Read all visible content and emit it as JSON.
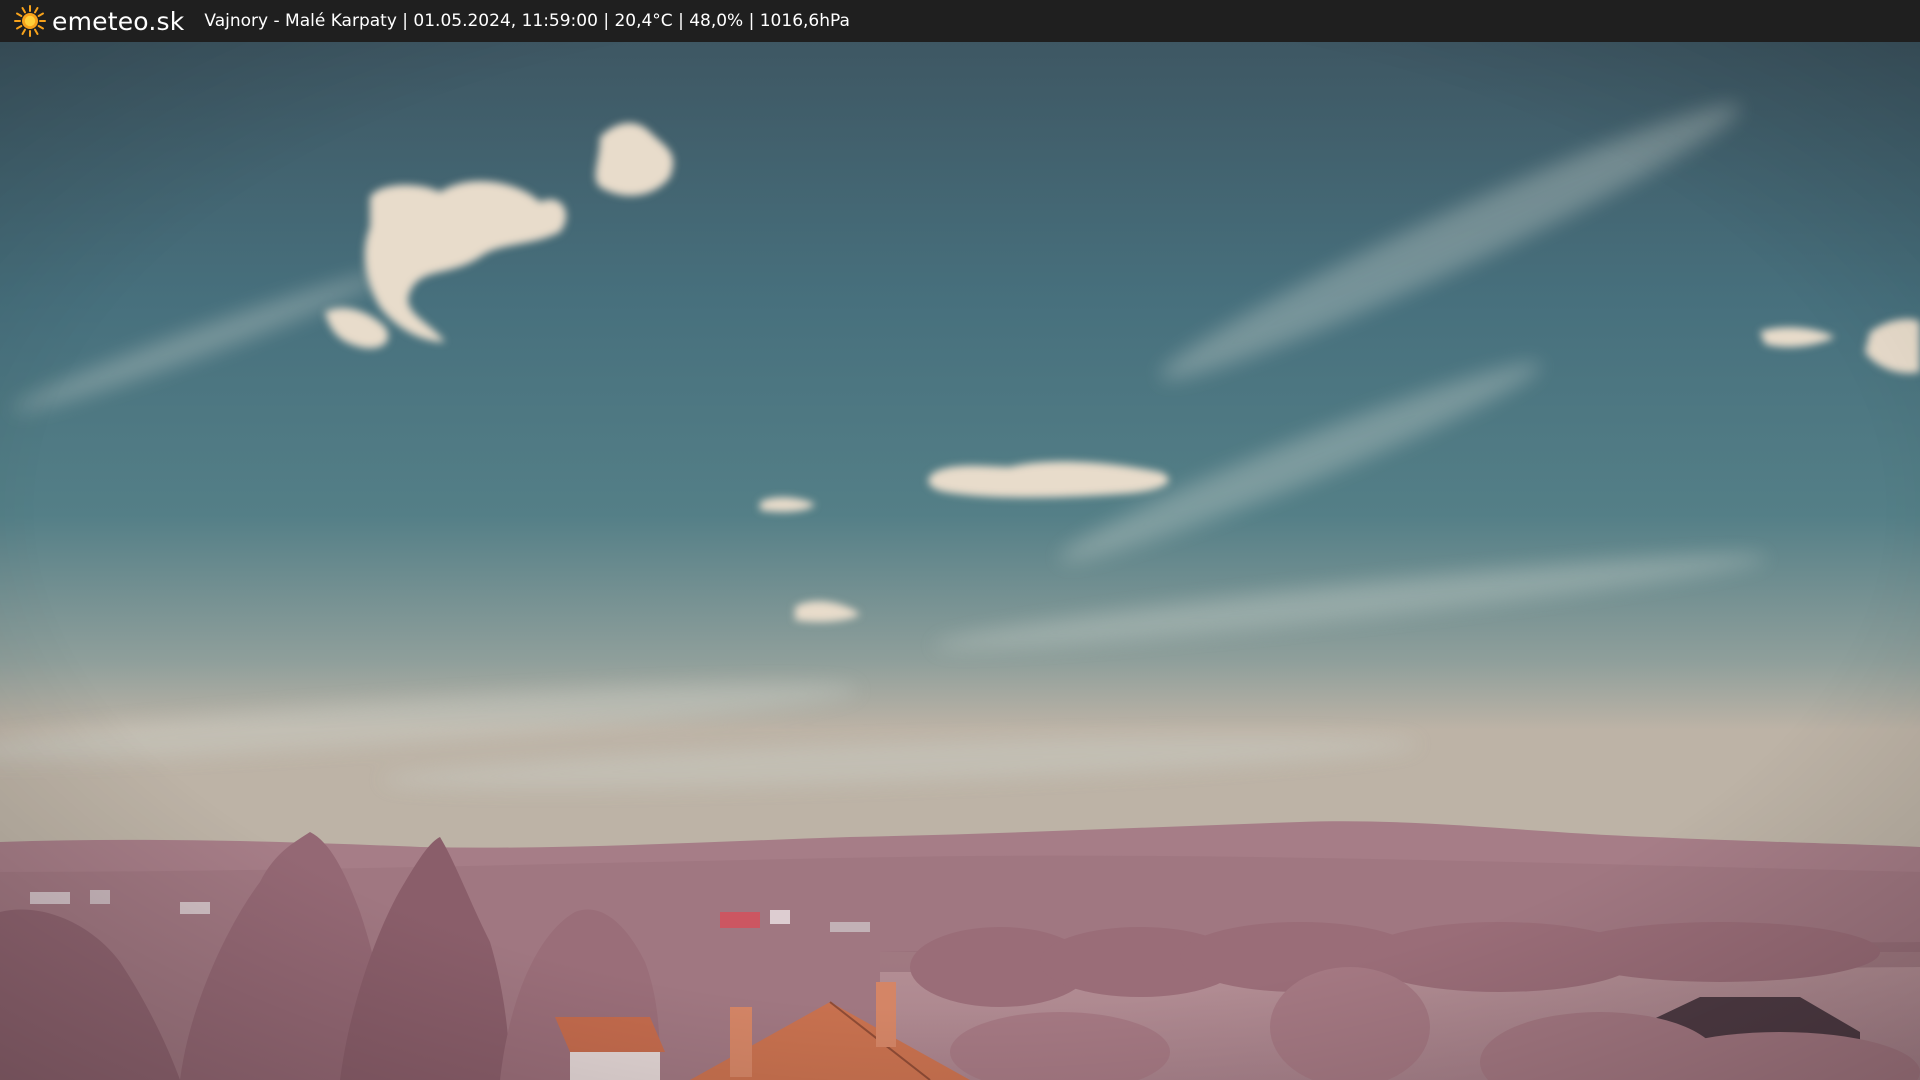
{
  "header": {
    "brand": "emeteo.sk",
    "caption": "Vajnory - Malé Karpaty | 01.05.2024, 11:59:00 | 20,4°C | 48,0% | 1016,6hPa",
    "icon": "sun-icon",
    "icon_color": "#f7a21b",
    "background": "#1f1f1f"
  },
  "scene": {
    "sky_top": "#3f5a66",
    "sky_mid": "#4e7680",
    "sky_horizon": "#b9b2a6",
    "hills": "#a27a84",
    "foliage": "#9c6f79",
    "roof": "#c7704e"
  }
}
